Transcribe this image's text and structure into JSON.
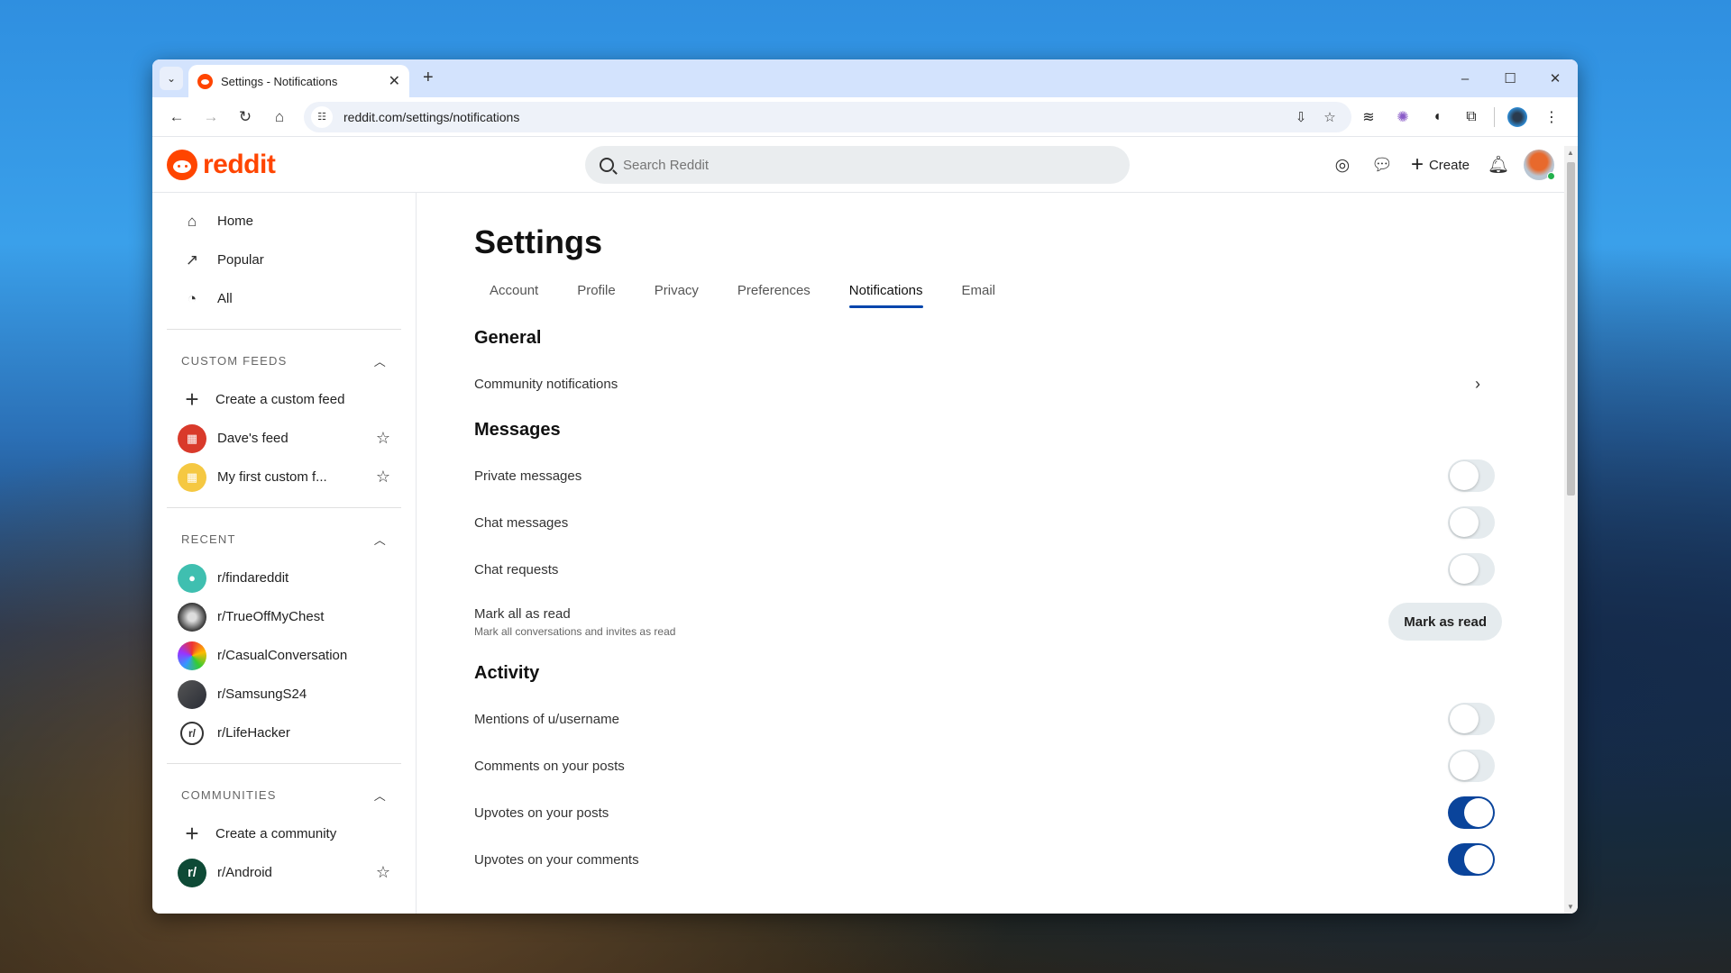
{
  "browser": {
    "tab_title": "Settings - Notifications",
    "url": "reddit.com/settings/notifications",
    "new_tab_label": "+",
    "window_controls": {
      "minimize": "–",
      "maximize": "☐",
      "close": "✕"
    }
  },
  "header": {
    "brand": "reddit",
    "search_placeholder": "Search Reddit",
    "create_label": "Create"
  },
  "sidebar": {
    "nav": [
      {
        "label": "Home",
        "icon": "home-icon"
      },
      {
        "label": "Popular",
        "icon": "popular-icon"
      },
      {
        "label": "All",
        "icon": "all-icon"
      }
    ],
    "custom_feeds": {
      "heading": "CUSTOM FEEDS",
      "create_label": "Create a custom feed",
      "items": [
        {
          "label": "Dave's feed",
          "color": "#d93a2b"
        },
        {
          "label": "My first custom f...",
          "color": "#f5c842"
        }
      ]
    },
    "recent": {
      "heading": "RECENT",
      "items": [
        {
          "label": "r/findareddit",
          "color": "#3fbfb0"
        },
        {
          "label": "r/TrueOffMyChest",
          "color": "#444444"
        },
        {
          "label": "r/CasualConversation",
          "color": "#3a7bd5"
        },
        {
          "label": "r/SamsungS24",
          "color": "#3b3f4a"
        },
        {
          "label": "r/LifeHacker",
          "color": "#ffffff"
        }
      ]
    },
    "communities": {
      "heading": "COMMUNITIES",
      "create_label": "Create a community",
      "items": [
        {
          "label": "r/Android",
          "color": "#0e4a36"
        }
      ]
    }
  },
  "settings": {
    "title": "Settings",
    "tabs": [
      "Account",
      "Profile",
      "Privacy",
      "Preferences",
      "Notifications",
      "Email"
    ],
    "active_tab": "Notifications",
    "sections": {
      "general": {
        "title": "General",
        "community_notifications": "Community notifications"
      },
      "messages": {
        "title": "Messages",
        "private_messages": {
          "label": "Private messages",
          "on": false
        },
        "chat_messages": {
          "label": "Chat messages",
          "on": false
        },
        "chat_requests": {
          "label": "Chat requests",
          "on": false
        },
        "mark_all": {
          "label": "Mark all as read",
          "sub": "Mark all conversations and invites as read",
          "button": "Mark as read"
        }
      },
      "activity": {
        "title": "Activity",
        "mentions": {
          "label": "Mentions of u/username",
          "on": false
        },
        "comments_posts": {
          "label": "Comments on your posts",
          "on": false
        },
        "upvotes_posts": {
          "label": "Upvotes on your posts",
          "on": true
        },
        "upvotes_comments": {
          "label": "Upvotes on your comments",
          "on": true
        }
      }
    }
  },
  "colors": {
    "brand": "#ff4500",
    "toggle_on": "#0a449b",
    "tab_underline": "#0045ac"
  }
}
